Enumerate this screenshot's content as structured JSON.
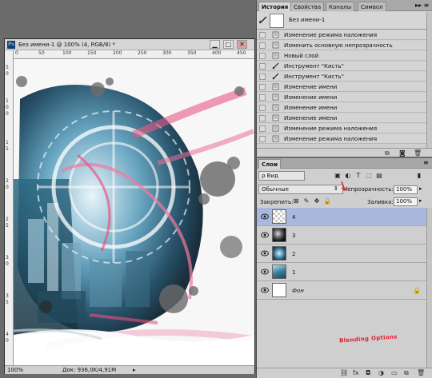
{
  "document": {
    "title": "Без имени-1 @ 100% (4, RGB/8) *",
    "ps_badge": "Ps",
    "window_buttons": {
      "minimize": "▁",
      "restore": "□",
      "close": "✕"
    },
    "ruler_top_numbers": [
      "0",
      "50",
      "100",
      "150",
      "200",
      "250",
      "300",
      "350",
      "400",
      "450"
    ],
    "ruler_left_numbers": [
      "5",
      "0",
      "1",
      "0",
      "0",
      "1",
      "5",
      "2",
      "0",
      "2",
      "5",
      "3",
      "0",
      "3",
      "5",
      "4",
      "0"
    ],
    "status_zoom": "100%",
    "status_doc": "Док: 936,0K/4,91M",
    "status_arrow": "▸"
  },
  "history_panel": {
    "tabs": [
      "История",
      "Свойства",
      "Каналы",
      "Символ"
    ],
    "active_tab": 0,
    "menu_glyph": "▸▸ ≡",
    "snapshot_label": "Без имени-1",
    "items": [
      {
        "label": "Изменение режима наложения",
        "icon": "action-icon"
      },
      {
        "label": "Изменить основную непрозрачность",
        "icon": "action-icon"
      },
      {
        "label": "Новый слой",
        "icon": "action-icon"
      },
      {
        "label": "Инструмент \"Кисть\"",
        "icon": "brush-icon"
      },
      {
        "label": "Инструмент \"Кисть\"",
        "icon": "brush-icon"
      },
      {
        "label": "Изменение имени",
        "icon": "action-icon"
      },
      {
        "label": "Изменение имени",
        "icon": "action-icon"
      },
      {
        "label": "Изменение имени",
        "icon": "action-icon"
      },
      {
        "label": "Изменение имени",
        "icon": "action-icon"
      },
      {
        "label": "Изменение режима наложения",
        "icon": "action-icon"
      },
      {
        "label": "Изменение режима наложения",
        "icon": "action-icon"
      }
    ]
  },
  "layers_panel": {
    "tab": "Слои",
    "menu_glyph": "≡",
    "filter_label": "ρ Вид",
    "blend_mode": "Обычные",
    "opacity_label": "Непрозрачность:",
    "opacity_value": "100%",
    "lock_label": "Закрепить:",
    "fill_label": "Заливка:",
    "fill_value": "100%",
    "annotation": "Blending Options",
    "layers": [
      {
        "name": "4",
        "selected": true,
        "thumb": "transparent"
      },
      {
        "name": "3",
        "selected": false,
        "thumb": "dark"
      },
      {
        "name": "2",
        "selected": false,
        "thumb": "blue"
      },
      {
        "name": "1",
        "selected": false,
        "thumb": "photo"
      },
      {
        "name": "Фон",
        "selected": false,
        "thumb": "white",
        "locked": true
      }
    ]
  },
  "colors": {
    "selected_layer": "#a9b8dc",
    "annotation": "#e8192c",
    "panel_bg": "#cfcfcf",
    "app_bg": "#6b6b6b"
  }
}
